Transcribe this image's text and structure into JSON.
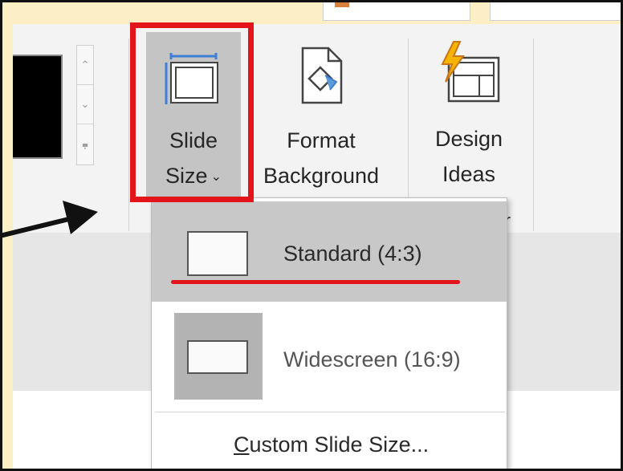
{
  "ribbon": {
    "slide_size": {
      "line1": "Slide",
      "line2": "Size",
      "caret": "⌄",
      "icon": "slide-size-icon"
    },
    "format_background": {
      "line1": "Format",
      "line2": "Background",
      "icon": "format-background-icon"
    },
    "design_ideas": {
      "line1": "Design",
      "line2": "Ideas",
      "icon": "design-ideas-icon"
    },
    "gallery_scroll": {
      "up": "⌃",
      "down": "⌄",
      "more": "⩦"
    },
    "group_label_fragment": "r"
  },
  "dropdown": {
    "items": [
      {
        "label": "Standard (4:3)",
        "selected": true
      },
      {
        "label": "Widescreen (16:9)",
        "selected": false
      }
    ],
    "custom": {
      "accel": "C",
      "rest": "ustom Slide Size..."
    }
  },
  "colors": {
    "annotation_red": "#e4141b",
    "hover_gray": "#c4c4c4",
    "page_bg": "#fcefc6"
  }
}
